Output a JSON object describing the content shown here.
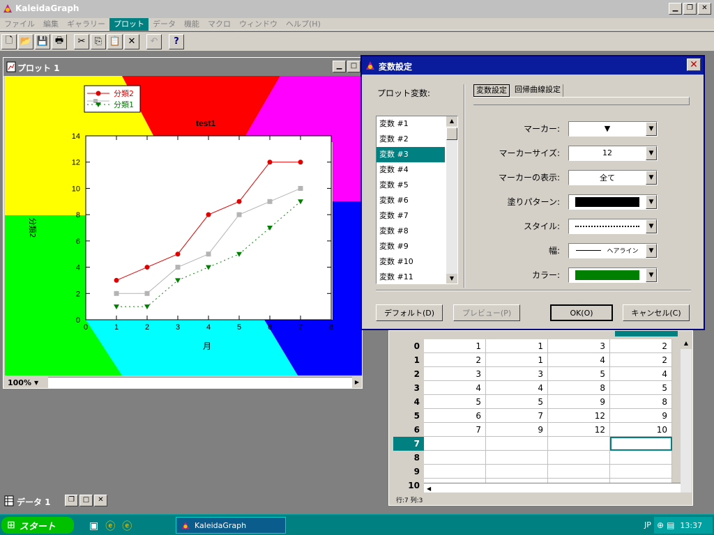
{
  "app": {
    "title": "KaleidaGraph"
  },
  "menu": [
    {
      "label": "ファイル",
      "active": false
    },
    {
      "label": "編集",
      "active": false
    },
    {
      "label": "ギャラリー",
      "active": false
    },
    {
      "label": "プロット",
      "active": true
    },
    {
      "label": "データ",
      "active": false
    },
    {
      "label": "機能",
      "active": false
    },
    {
      "label": "マクロ",
      "active": false
    },
    {
      "label": "ウィンドウ",
      "active": false
    },
    {
      "label": "ヘルプ(H)",
      "active": false
    }
  ],
  "toolbar": [
    {
      "name": "new-icon",
      "glyph": "🗋"
    },
    {
      "name": "open-icon",
      "glyph": "📂"
    },
    {
      "name": "save-icon",
      "glyph": "💾"
    },
    {
      "name": "print-icon",
      "glyph": "🖶"
    },
    {
      "name": "sep"
    },
    {
      "name": "cut-icon",
      "glyph": "✂"
    },
    {
      "name": "copy-icon",
      "glyph": "⎘"
    },
    {
      "name": "paste-icon",
      "glyph": "📋"
    },
    {
      "name": "delete-icon",
      "glyph": "✕"
    },
    {
      "name": "sep"
    },
    {
      "name": "undo-icon",
      "glyph": "↶"
    },
    {
      "name": "sep"
    },
    {
      "name": "help-icon",
      "glyph": "?"
    }
  ],
  "plot_window": {
    "title": "プロット 1",
    "zoom": "100%"
  },
  "chart_data": {
    "type": "line",
    "title": "test1",
    "xlabel": "月",
    "ylabel": "分類2",
    "xlim": [
      0,
      8
    ],
    "ylim": [
      0,
      14
    ],
    "x_ticks": [
      0,
      1,
      2,
      3,
      4,
      5,
      6,
      7,
      8
    ],
    "y_ticks": [
      0,
      2,
      4,
      6,
      8,
      10,
      12,
      14
    ],
    "legend_position": "top-left",
    "grid": false,
    "series": [
      {
        "name": "分類2",
        "x": [
          1,
          2,
          3,
          4,
          5,
          6,
          7
        ],
        "values": [
          3,
          4,
          5,
          8,
          9,
          12,
          12
        ],
        "color": "#e00000",
        "marker": "circle",
        "line": "solid",
        "legend": true
      },
      {
        "name": "",
        "x": [
          1,
          2,
          3,
          4,
          5,
          6,
          7
        ],
        "values": [
          2,
          2,
          4,
          5,
          8,
          9,
          10
        ],
        "color": "#b4b4b4",
        "marker": "square",
        "line": "solid",
        "legend": false
      },
      {
        "name": "分類1",
        "x": [
          1,
          2,
          3,
          4,
          5,
          6,
          7
        ],
        "values": [
          1,
          1,
          3,
          4,
          5,
          7,
          9
        ],
        "color": "#008000",
        "marker": "triangle-down",
        "line": "dotted",
        "legend": true
      }
    ],
    "background_colors": [
      "#ffff00",
      "#ff0000",
      "#ff00ff",
      "#0000ff",
      "#00ffff",
      "#00ff00"
    ]
  },
  "dialog": {
    "title": "変数設定",
    "plot_var_label": "プロット変数:",
    "variables": [
      "変数 #1",
      "変数 #2",
      "変数 #3",
      "変数 #4",
      "変数 #5",
      "変数 #6",
      "変数 #7",
      "変数 #8",
      "変数 #9",
      "変数 #10",
      "変数 #11"
    ],
    "selected_index": 2,
    "tabs": [
      "変数設定",
      "回帰曲線設定"
    ],
    "fields": [
      {
        "label": "マーカー:",
        "value": "▼",
        "kind": "text"
      },
      {
        "label": "マーカーサイズ:",
        "value": "12",
        "kind": "text"
      },
      {
        "label": "マーカーの表示:",
        "value": "全て",
        "kind": "text"
      },
      {
        "label": "塗りパターン:",
        "value": "",
        "kind": "swatch",
        "color": "#000000"
      },
      {
        "label": "スタイル:",
        "value": "",
        "kind": "dotted"
      },
      {
        "label": "幅:",
        "value": "ヘアライン",
        "kind": "line"
      },
      {
        "label": "カラー:",
        "value": "",
        "kind": "swatch",
        "color": "#008000"
      }
    ],
    "buttons": {
      "default": "デフォルト(D)",
      "preview": "プレビュー(P)",
      "ok": "OK(O)",
      "cancel": "キャンセル(C)"
    }
  },
  "data_window": {
    "rows": [
      {
        "index": "0",
        "cells": [
          "1",
          "1",
          "3",
          "2"
        ]
      },
      {
        "index": "1",
        "cells": [
          "2",
          "1",
          "4",
          "2"
        ]
      },
      {
        "index": "2",
        "cells": [
          "3",
          "3",
          "5",
          "4"
        ]
      },
      {
        "index": "3",
        "cells": [
          "4",
          "4",
          "8",
          "5"
        ]
      },
      {
        "index": "4",
        "cells": [
          "5",
          "5",
          "9",
          "8"
        ]
      },
      {
        "index": "5",
        "cells": [
          "6",
          "7",
          "12",
          "9"
        ]
      },
      {
        "index": "6",
        "cells": [
          "7",
          "9",
          "12",
          "10"
        ]
      },
      {
        "index": "7",
        "cells": [
          "",
          "",
          "",
          ""
        ]
      },
      {
        "index": "8",
        "cells": [
          "",
          "",
          "",
          ""
        ]
      },
      {
        "index": "9",
        "cells": [
          "",
          "",
          "",
          ""
        ]
      },
      {
        "index": "10",
        "cells": [
          "",
          "",
          "",
          ""
        ]
      }
    ],
    "selected_row": 7,
    "status": "行:7  列:3"
  },
  "minimized": {
    "title": "データ 1"
  },
  "taskbar": {
    "start": "スタート",
    "app": "KaleidaGraph",
    "lang": "JP",
    "clock": "13:37"
  }
}
